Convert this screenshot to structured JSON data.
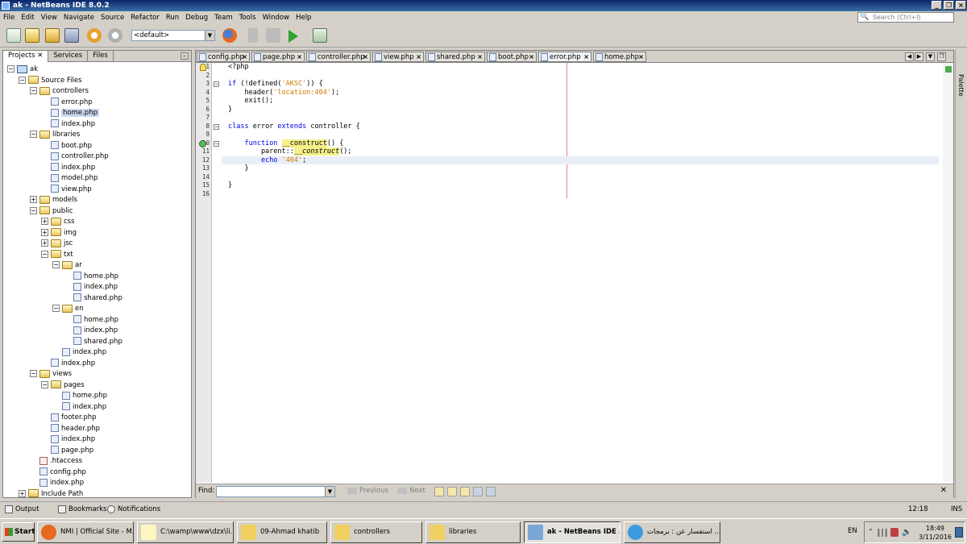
{
  "window": {
    "title": "ak - NetBeans IDE 8.0.2"
  },
  "menu": [
    "File",
    "Edit",
    "View",
    "Navigate",
    "Source",
    "Refactor",
    "Run",
    "Debug",
    "Team",
    "Tools",
    "Window",
    "Help"
  ],
  "search": {
    "placeholder": "Search (Ctrl+I)"
  },
  "toolbar": {
    "config": "<default>"
  },
  "left_tabs": [
    "Projects",
    "Services",
    "Files"
  ],
  "tree": [
    {
      "label": "ak",
      "depth": 0,
      "kind": "project",
      "exp": "-"
    },
    {
      "label": "Source Files",
      "depth": 1,
      "kind": "folder",
      "exp": "-"
    },
    {
      "label": "controllers",
      "depth": 2,
      "kind": "folder",
      "exp": "-"
    },
    {
      "label": "error.php",
      "depth": 3,
      "kind": "php"
    },
    {
      "label": "home.php",
      "depth": 3,
      "kind": "php",
      "selected": true
    },
    {
      "label": "index.php",
      "depth": 3,
      "kind": "php"
    },
    {
      "label": "libraries",
      "depth": 2,
      "kind": "folder",
      "exp": "-"
    },
    {
      "label": "boot.php",
      "depth": 3,
      "kind": "php"
    },
    {
      "label": "controller.php",
      "depth": 3,
      "kind": "php"
    },
    {
      "label": "index.php",
      "depth": 3,
      "kind": "php"
    },
    {
      "label": "model.php",
      "depth": 3,
      "kind": "php"
    },
    {
      "label": "view.php",
      "depth": 3,
      "kind": "php"
    },
    {
      "label": "models",
      "depth": 2,
      "kind": "folder",
      "exp": "+"
    },
    {
      "label": "public",
      "depth": 2,
      "kind": "folder",
      "exp": "-"
    },
    {
      "label": "css",
      "depth": 3,
      "kind": "folder",
      "exp": "+"
    },
    {
      "label": "img",
      "depth": 3,
      "kind": "folder",
      "exp": "+"
    },
    {
      "label": "jsc",
      "depth": 3,
      "kind": "folder",
      "exp": "+"
    },
    {
      "label": "txt",
      "depth": 3,
      "kind": "folder",
      "exp": "-"
    },
    {
      "label": "ar",
      "depth": 4,
      "kind": "folder",
      "exp": "-"
    },
    {
      "label": "home.php",
      "depth": 5,
      "kind": "php"
    },
    {
      "label": "index.php",
      "depth": 5,
      "kind": "php"
    },
    {
      "label": "shared.php",
      "depth": 5,
      "kind": "php"
    },
    {
      "label": "en",
      "depth": 4,
      "kind": "folder",
      "exp": "-"
    },
    {
      "label": "home.php",
      "depth": 5,
      "kind": "php"
    },
    {
      "label": "index.php",
      "depth": 5,
      "kind": "php"
    },
    {
      "label": "shared.php",
      "depth": 5,
      "kind": "php"
    },
    {
      "label": "index.php",
      "depth": 4,
      "kind": "php"
    },
    {
      "label": "index.php",
      "depth": 3,
      "kind": "php"
    },
    {
      "label": "views",
      "depth": 2,
      "kind": "folder",
      "exp": "-"
    },
    {
      "label": "pages",
      "depth": 3,
      "kind": "folder",
      "exp": "-"
    },
    {
      "label": "home.php",
      "depth": 4,
      "kind": "php"
    },
    {
      "label": "index.php",
      "depth": 4,
      "kind": "php"
    },
    {
      "label": "footer.php",
      "depth": 3,
      "kind": "php"
    },
    {
      "label": "header.php",
      "depth": 3,
      "kind": "php"
    },
    {
      "label": "index.php",
      "depth": 3,
      "kind": "php"
    },
    {
      "label": "page.php",
      "depth": 3,
      "kind": "php"
    },
    {
      "label": ".htaccess",
      "depth": 2,
      "kind": "ht"
    },
    {
      "label": "config.php",
      "depth": 2,
      "kind": "php"
    },
    {
      "label": "index.php",
      "depth": 2,
      "kind": "php"
    },
    {
      "label": "Include Path",
      "depth": 1,
      "kind": "folder",
      "exp": "+"
    }
  ],
  "editor_tabs": [
    {
      "label": "config.php"
    },
    {
      "label": "page.php"
    },
    {
      "label": "controller.php"
    },
    {
      "label": "view.php"
    },
    {
      "label": "shared.php"
    },
    {
      "label": "boot.php"
    },
    {
      "label": "error.php",
      "active": true
    },
    {
      "label": "home.php"
    }
  ],
  "code_lines": [
    {
      "n": "1",
      "html": "&lt;?php"
    },
    {
      "n": "2",
      "html": ""
    },
    {
      "n": "3",
      "html": "<span class='kw'>if</span> (!defined(<span class='str'>'AKSC'</span>)) {"
    },
    {
      "n": "4",
      "html": "    header(<span class='str'>'location:404'</span>);"
    },
    {
      "n": "5",
      "html": "    exit();"
    },
    {
      "n": "6",
      "html": "}"
    },
    {
      "n": "7",
      "html": ""
    },
    {
      "n": "8",
      "html": "<span class='kw'>class</span> error <span class='kw'>extends</span> controller {"
    },
    {
      "n": "9",
      "html": ""
    },
    {
      "n": "10",
      "html": "    <span class='kw'>function</span> <span class='hi'>__construct</span>() {"
    },
    {
      "n": "11",
      "html": "        parent::<span class='hi it'>__construct</span>();"
    },
    {
      "n": "12",
      "html": "        <span class='kw'>echo</span> <span class='str'>'404'</span>;"
    },
    {
      "n": "13",
      "html": "    }"
    },
    {
      "n": "14",
      "html": ""
    },
    {
      "n": "15",
      "html": "}"
    },
    {
      "n": "16",
      "html": ""
    }
  ],
  "find": {
    "label": "Find:",
    "previous": "Previous",
    "next": "Next"
  },
  "palette_label": "Palette",
  "status": {
    "output": "Output",
    "bookmarks": "Bookmarks",
    "notifications": "Notifications",
    "position": "12:18",
    "mode": "INS"
  },
  "taskbar": {
    "start": "Start",
    "tasks": [
      {
        "label": "NMI | Official Site - M...",
        "color": "#e8681e"
      },
      {
        "label": "C:\\wamp\\www\\dzx\\li...",
        "color": "#fff5c0"
      },
      {
        "label": "09-Ahmad khatib",
        "color": "#f0d060"
      },
      {
        "label": "controllers",
        "color": "#f0d060"
      },
      {
        "label": "libraries",
        "color": "#f0d060"
      },
      {
        "label": "ak - NetBeans IDE ...",
        "color": "#7aa6d8",
        "active": true
      },
      {
        "label": "استفسار عن : برمجات ...",
        "color": "#3c9be0"
      }
    ],
    "lang": "EN",
    "time": "18:49",
    "date": "3/11/2016"
  }
}
